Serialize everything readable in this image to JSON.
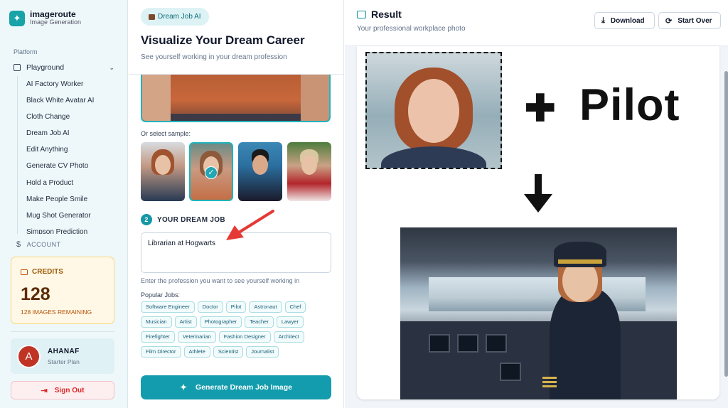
{
  "brand": {
    "name": "imageroute",
    "subtitle": "Image Generation",
    "logo_icon": "sparkle-icon"
  },
  "sidebar": {
    "section_label": "Platform",
    "parent_item": "Playground",
    "items": [
      {
        "label": "AI Factory Worker"
      },
      {
        "label": "Black White Avatar AI"
      },
      {
        "label": "Cloth Change"
      },
      {
        "label": "Dream Job AI"
      },
      {
        "label": "Edit Anything"
      },
      {
        "label": "Generate CV Photo"
      },
      {
        "label": "Hold a Product"
      },
      {
        "label": "Make People Smile"
      },
      {
        "label": "Mug Shot Generator"
      },
      {
        "label": "Simpson Prediction"
      }
    ],
    "account_label": "ACCOUNT"
  },
  "credits": {
    "label": "CREDITS",
    "count": "128",
    "remaining": "128 IMAGES REMAINING"
  },
  "user": {
    "initial": "A",
    "name": "AHANAF",
    "plan": "Starter Plan"
  },
  "signout": {
    "label": "Sign Out"
  },
  "form": {
    "tag": "Dream Job AI",
    "title": "Visualize Your Dream Career",
    "subtitle": "See yourself working in your dream profession",
    "or_select_sample": "Or select sample:",
    "step_number": "2",
    "step_label": "YOUR DREAM JOB",
    "job_value": "Librarian at Hogwarts",
    "hint": "Enter the profession you want to see yourself working in",
    "popular_label": "Popular Jobs:",
    "popular_jobs": [
      [
        "Software Engineer",
        "Doctor",
        "Pilot",
        "Astronaut",
        "Chef"
      ],
      [
        "Musician",
        "Artist",
        "Photographer",
        "Teacher",
        "Lawyer"
      ],
      [
        "Firefighter",
        "Veterinarian",
        "Fashion Designer",
        "Architect"
      ],
      [
        "Film Director",
        "Athlete",
        "Scientist",
        "Journalist"
      ]
    ],
    "generate_label": "Generate Dream Job Image"
  },
  "result": {
    "title": "Result",
    "subtitle": "Your professional workplace photo",
    "download_label": "Download",
    "start_over_label": "Start Over",
    "image_text": {
      "plus": "✚",
      "job_word": "Pilot"
    }
  },
  "colors": {
    "accent": "#139cad",
    "annotation_arrow": "#e53935",
    "credits_border": "#f6d77c",
    "signout": "#dc2626"
  }
}
